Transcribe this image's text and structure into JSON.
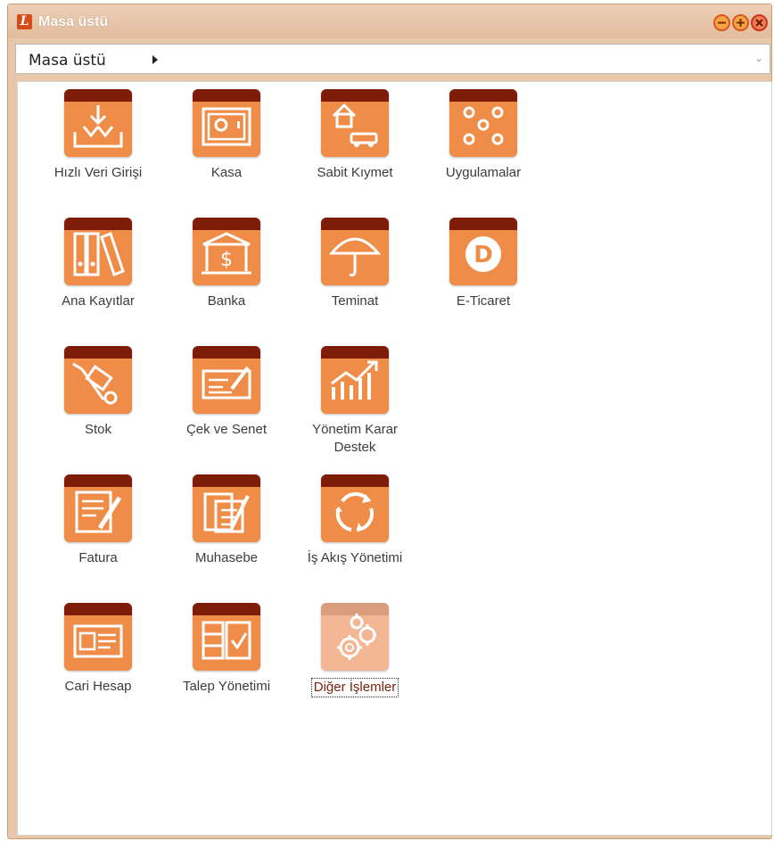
{
  "window": {
    "title": "Masa üstü",
    "logo_letter": "L",
    "controls": [
      "minimize-icon",
      "maximize-icon",
      "close-icon"
    ]
  },
  "address": {
    "crumb": "Masa üstü"
  },
  "colors": {
    "tile": "#ef8d48",
    "tile_band": "#7d1d09",
    "tile_disabled": "#f3b796",
    "frame": "#e8c7aa"
  },
  "tiles": [
    {
      "label": "Hızlı Veri Girişi",
      "icon": "download-icon"
    },
    {
      "label": "Kasa",
      "icon": "safe-icon"
    },
    {
      "label": "Sabit Kıymet",
      "icon": "house-car-icon"
    },
    {
      "label": "Uygulamalar",
      "icon": "dots-icon"
    },
    {
      "label": "Ana Kayıtlar",
      "icon": "binders-icon"
    },
    {
      "label": "Banka",
      "icon": "bank-icon"
    },
    {
      "label": "Teminat",
      "icon": "umbrella-icon"
    },
    {
      "label": "E-Ticaret",
      "icon": "d-coin-icon"
    },
    {
      "label": "Stok",
      "icon": "hand-truck-icon"
    },
    {
      "label": "Çek ve Senet",
      "icon": "cheque-icon"
    },
    {
      "label": "Yönetim Karar Destek",
      "icon": "growth-chart-icon"
    },
    {
      "label": "Fatura",
      "icon": "invoice-icon"
    },
    {
      "label": "Muhasebe",
      "icon": "ledger-icon"
    },
    {
      "label": "İş Akış Yönetimi",
      "icon": "workflow-cycle-icon"
    },
    {
      "label": "Cari Hesap",
      "icon": "account-card-icon"
    },
    {
      "label": "Talep Yönetimi",
      "icon": "checklist-icon"
    },
    {
      "label": "Diğer İşlemler",
      "icon": "gears-icon",
      "selected": true,
      "disabled": true
    }
  ]
}
